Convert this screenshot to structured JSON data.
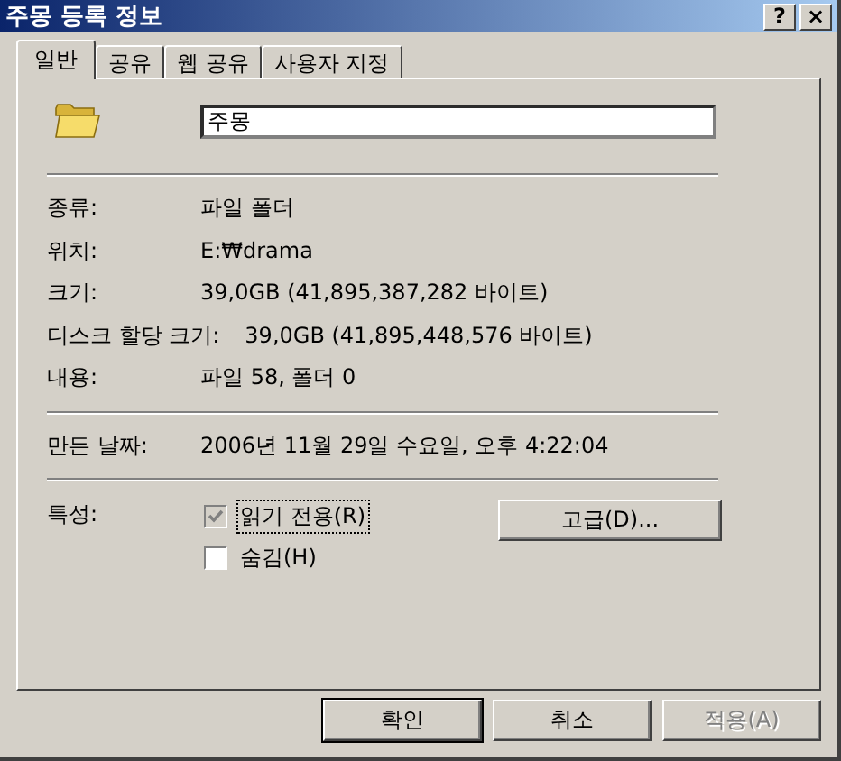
{
  "window": {
    "title": "주몽 등록 정보",
    "help": "?",
    "close": "×"
  },
  "tabs": [
    {
      "label": "일반",
      "selected": true
    },
    {
      "label": "공유",
      "selected": false
    },
    {
      "label": "웹 공유",
      "selected": false
    },
    {
      "label": "사용자 지정",
      "selected": false
    }
  ],
  "name_field": {
    "value": "주몽"
  },
  "info_rows": [
    {
      "label": "종류:",
      "value": "파일 폴더"
    },
    {
      "label": "위치:",
      "value": "E:₩drama"
    },
    {
      "label": "크기:",
      "value": "39,0GB (41,895,387,282 바이트)"
    },
    {
      "label": "디스크 할당 크기:",
      "value": "39,0GB (41,895,448,576 바이트)"
    },
    {
      "label": "내용:",
      "value": "파일 58, 폴더 0"
    }
  ],
  "date_rows": [
    {
      "label": "만든 날짜:",
      "value": "2006년 11월 29일 수요일, 오후 4:22:04"
    }
  ],
  "attributes": {
    "label": "특성:",
    "checkboxes": [
      {
        "label": "읽기 전용(R)",
        "checked": true,
        "greyed": true,
        "focused": true
      },
      {
        "label": "숨김(H)",
        "checked": false,
        "greyed": false,
        "focused": false
      }
    ],
    "advanced_button": "고급(D)..."
  },
  "buttons": [
    {
      "label": "확인",
      "default": true,
      "disabled": false
    },
    {
      "label": "취소",
      "default": false,
      "disabled": false
    },
    {
      "label": "적용(A)",
      "default": false,
      "disabled": true
    }
  ]
}
